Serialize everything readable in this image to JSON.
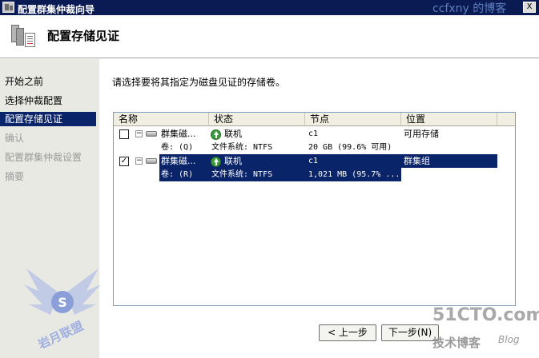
{
  "window": {
    "title": "配置群集仲裁向导",
    "watermark": "ccfxny 的博客",
    "close_glyph": "X"
  },
  "header": {
    "title": "配置存储见证"
  },
  "nav": {
    "steps": [
      {
        "label": "开始之前",
        "state": "done"
      },
      {
        "label": "选择仲裁配置",
        "state": "done"
      },
      {
        "label": "配置存储见证",
        "state": "active"
      },
      {
        "label": "确认",
        "state": "pending"
      },
      {
        "label": "配置群集仲裁设置",
        "state": "pending"
      },
      {
        "label": "摘要",
        "state": "pending"
      }
    ]
  },
  "main": {
    "instruction": "请选择要将其指定为磁盘见证的存储卷。",
    "columns": [
      "名称",
      "状态",
      "节点",
      "位置"
    ],
    "rows": [
      {
        "checked": false,
        "check_glyph": "",
        "expander": "−",
        "name": "群集磁...",
        "status": "联机",
        "node": "c1",
        "location": "可用存储",
        "volume": "卷: (Q)",
        "filesystem": "文件系统: NTFS",
        "size": "20 GB (99.6% 可用)",
        "selected": false
      },
      {
        "checked": true,
        "check_glyph": "✓",
        "expander": "−",
        "name": "群集磁...",
        "status": "联机",
        "node": "c1",
        "location": "群集组",
        "volume": "卷: (R)",
        "filesystem": "文件系统: NTFS",
        "size": "1,021 MB (95.7% ...",
        "selected": true
      }
    ]
  },
  "buttons": {
    "back": "< 上一步",
    "next": "下一步(N)"
  },
  "watermarks": {
    "site": "51CTO.com",
    "blog": "技术博客",
    "blog_suffix": "Blog",
    "logo_text": "岩月联盟"
  },
  "colors": {
    "title_bar": "#0a1b54",
    "selection": "#0a246a",
    "nav_bg": "#e9e9e3"
  }
}
